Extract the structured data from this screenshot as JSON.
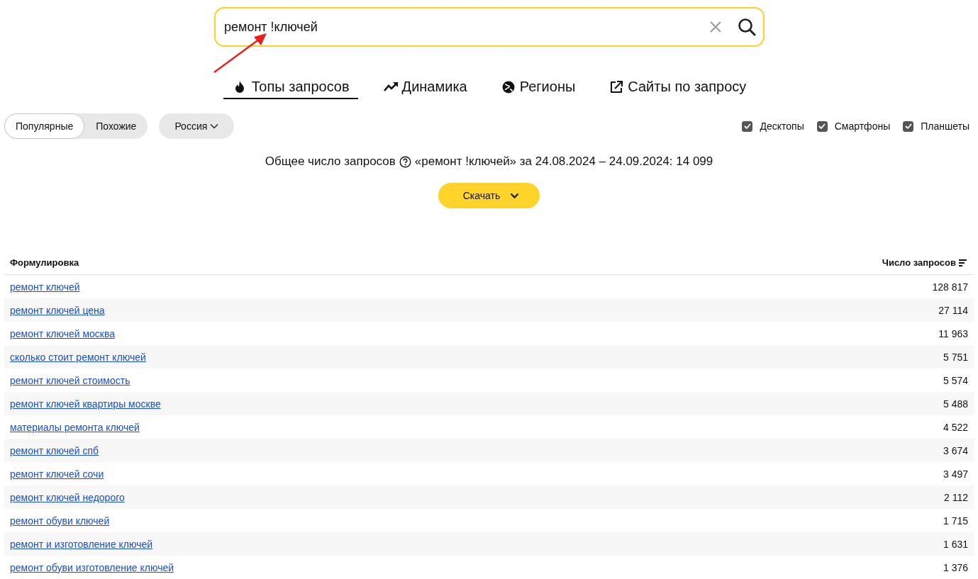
{
  "search": {
    "value": "ремонт !ключей"
  },
  "tabs": [
    {
      "label": "Топы запросов",
      "kind": "fire",
      "selected": true
    },
    {
      "label": "Динамика",
      "kind": "trend",
      "selected": false
    },
    {
      "label": "Регионы",
      "kind": "globe",
      "selected": false
    },
    {
      "label": "Сайты по запросу",
      "kind": "external",
      "selected": false
    }
  ],
  "mode_switch": [
    {
      "label": "Популярные",
      "selected": true
    },
    {
      "label": "Похожие",
      "selected": false
    }
  ],
  "region": {
    "label": "Россия"
  },
  "devices": [
    {
      "label": "Десктопы",
      "checked": true
    },
    {
      "label": "Смартфоны",
      "checked": true
    },
    {
      "label": "Планшеты",
      "checked": true
    }
  ],
  "summary": {
    "label": "Общее число запросов",
    "text": "«ремонт !ключей» за 24.08.2024 – 24.09.2024: 14 099"
  },
  "download_button": {
    "label": "Скачать"
  },
  "table": {
    "columns": [
      "Формулировка",
      "Число запросов"
    ],
    "rows": [
      {
        "phrase": "ремонт ключей",
        "count": "128 817"
      },
      {
        "phrase": "ремонт ключей цена",
        "count": "27 114"
      },
      {
        "phrase": "ремонт ключей москва",
        "count": "11 963"
      },
      {
        "phrase": "сколько стоит ремонт ключей",
        "count": "5 751"
      },
      {
        "phrase": "ремонт ключей стоимость",
        "count": "5 574"
      },
      {
        "phrase": "ремонт ключей квартиры москве",
        "count": "5 488"
      },
      {
        "phrase": "материалы ремонта ключей",
        "count": "4 522"
      },
      {
        "phrase": "ремонт ключей спб",
        "count": "3 674"
      },
      {
        "phrase": "ремонт ключей сочи",
        "count": "3 497"
      },
      {
        "phrase": "ремонт ключей недорого",
        "count": "2 112"
      },
      {
        "phrase": "ремонт обуви ключей",
        "count": "1 715"
      },
      {
        "phrase": "ремонт и изготовление ключей",
        "count": "1 631"
      },
      {
        "phrase": "ремонт обуви изготовление ключей",
        "count": "1 376"
      }
    ]
  }
}
